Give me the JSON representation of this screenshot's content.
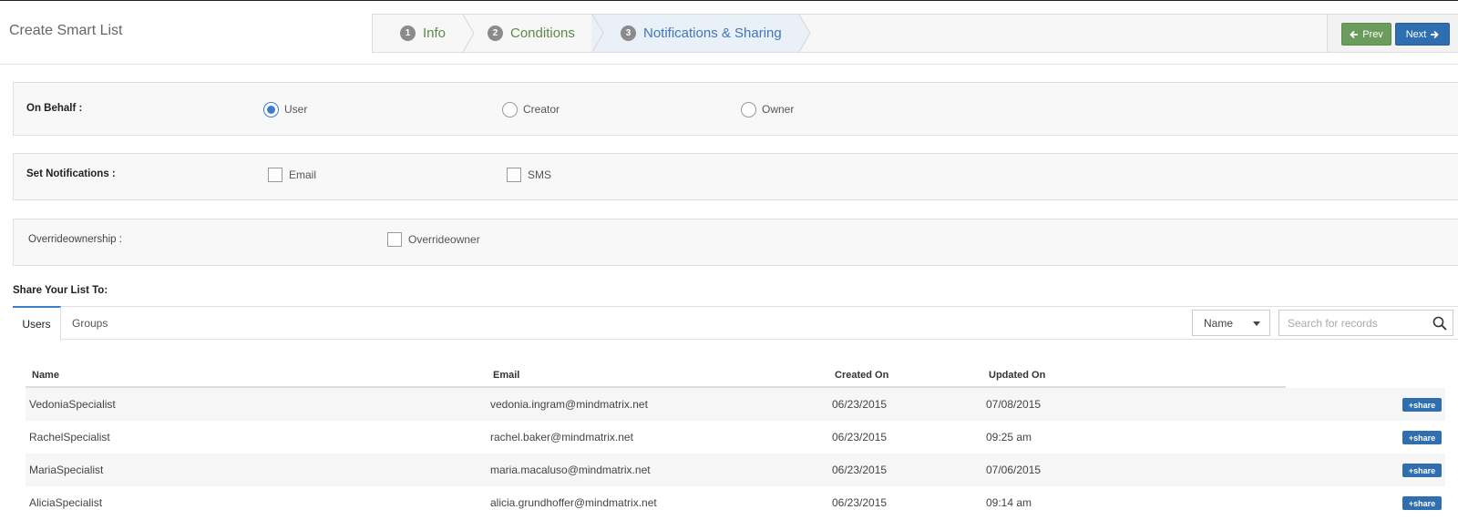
{
  "header": {
    "title": "Create Smart List",
    "steps": [
      {
        "number": "1",
        "label": "Info"
      },
      {
        "number": "2",
        "label": "Conditions"
      },
      {
        "number": "3",
        "label": "Notifications & Sharing"
      }
    ],
    "prev_label": "Prev",
    "next_label": "Next"
  },
  "on_behalf": {
    "label": "On Behalf :",
    "options": [
      {
        "label": "User",
        "checked": true
      },
      {
        "label": "Creator",
        "checked": false
      },
      {
        "label": "Owner",
        "checked": false
      }
    ]
  },
  "notifications": {
    "label": "Set Notifications :",
    "options": [
      {
        "label": "Email",
        "checked": false
      },
      {
        "label": "SMS",
        "checked": false
      }
    ]
  },
  "override": {
    "label": "Overrideownership :",
    "option_label": "Overrideowner",
    "checked": false
  },
  "share": {
    "title": "Share Your List To:",
    "tabs": [
      {
        "label": "Users",
        "active": true
      },
      {
        "label": "Groups",
        "active": false
      }
    ],
    "filter_value": "Name",
    "search_placeholder": "Search for records",
    "columns": [
      "Name",
      "Email",
      "Created On",
      "Updated On"
    ],
    "share_button_label": "share",
    "rows": [
      {
        "name": "VedoniaSpecialist",
        "email": "vedonia.ingram@mindmatrix.net",
        "created": "06/23/2015",
        "updated": "07/08/2015"
      },
      {
        "name": "RachelSpecialist",
        "email": "rachel.baker@mindmatrix.net",
        "created": "06/23/2015",
        "updated": "09:25 am"
      },
      {
        "name": "MariaSpecialist",
        "email": "maria.macaluso@mindmatrix.net",
        "created": "06/23/2015",
        "updated": "07/06/2015"
      },
      {
        "name": "AliciaSpecialist",
        "email": "alicia.grundhoffer@mindmatrix.net",
        "created": "06/23/2015",
        "updated": "09:14 am"
      }
    ]
  },
  "colors": {
    "accent": "#3d7ec4",
    "step_text": "#5b8a45",
    "prev_button": "#6b9c5b",
    "next_button": "#2f6fb0"
  }
}
